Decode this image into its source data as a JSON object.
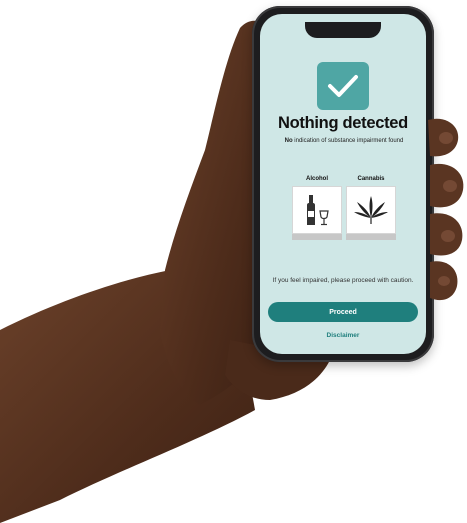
{
  "screen": {
    "result_title": "Nothing detected",
    "subtitle_bold": "No",
    "subtitle_rest": " indication of substance impairment found",
    "categories": [
      {
        "label": "Alcohol",
        "icon": "alcohol-bottle-glass-icon"
      },
      {
        "label": "Cannabis",
        "icon": "cannabis-leaf-icon"
      }
    ],
    "warning_text": "If you feel impaired, please proceed with caution.",
    "proceed_label": "Proceed",
    "disclaimer_label": "Disclaimer"
  },
  "colors": {
    "screen_bg": "#cfe7e6",
    "accent": "#1f7f7d",
    "check_bg": "#4fa6a4",
    "skin": "#5a3522"
  }
}
